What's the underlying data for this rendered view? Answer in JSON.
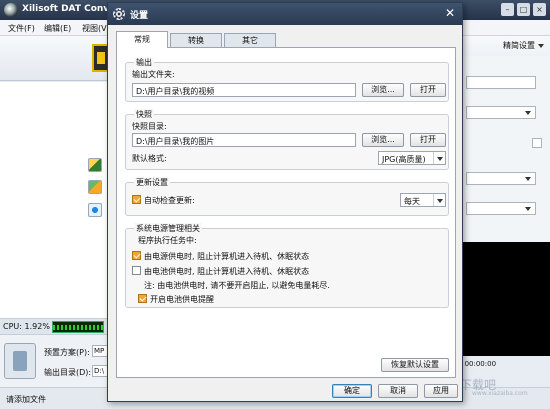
{
  "main_window": {
    "title": "Xilisoft DAT Converter",
    "menu": [
      "文件(F)",
      "编辑(E)",
      "视图(V)"
    ],
    "advanced_settings": "精简设置",
    "cpu": "CPU: 1.92%",
    "preset_label": "预置方案(P):",
    "preset_value": "MP",
    "output_label": "输出目录(D):",
    "output_value": "D:\\",
    "status": "请添加文件",
    "player_time": "/ 00:00:00"
  },
  "dialog": {
    "title": "设置",
    "tabs": [
      "常规",
      "转换",
      "其它"
    ],
    "active_tab": 0,
    "output_group": {
      "title": "输出",
      "folder_label": "输出文件夹:",
      "folder_value": "D:\\用户目录\\我的视频",
      "browse": "浏览...",
      "open": "打开"
    },
    "snapshot_group": {
      "title": "快照",
      "dir_label": "快照目录:",
      "dir_value": "D:\\用户目录\\我的图片",
      "browse": "浏览...",
      "open": "打开",
      "format_label": "默认格式:",
      "format_value": "JPG(高质量)"
    },
    "update_group": {
      "title": "更新设置",
      "auto_check": "自动检查更新:",
      "auto_check_checked": true,
      "frequency": "每天"
    },
    "power_group": {
      "title": "系统电源管理相关",
      "subtitle": "程序执行任务中:",
      "ac_option": "由电源供电时, 阻止计算机进入待机、休眠状态",
      "ac_checked": true,
      "battery_option": "由电池供电时, 阻止计算机进入待机、休眠状态",
      "battery_checked": false,
      "note": "注: 由电池供电时, 请不要开启阻止, 以避免电量耗尽.",
      "battery_alert": "开启电池供电提醒",
      "battery_alert_checked": true
    },
    "restore_defaults": "恢复默认设置",
    "ok": "确定",
    "cancel": "取消",
    "apply": "应用"
  },
  "watermark": {
    "text": "下载吧",
    "domain": "www.xiazaiba.com"
  }
}
